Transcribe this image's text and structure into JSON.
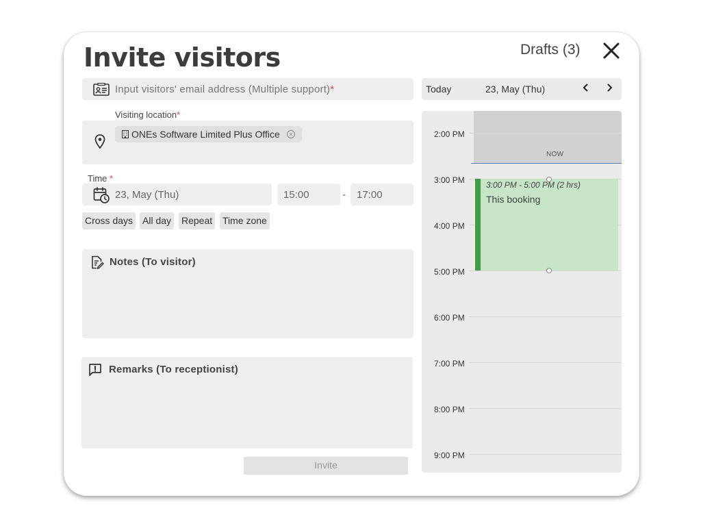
{
  "dialog": {
    "title": "Invite visitors",
    "drafts_label": "Drafts (3)"
  },
  "email": {
    "placeholder": "Input visitors' email address (Multiple support)",
    "required_mark": "*"
  },
  "location": {
    "label": "Visiting location",
    "required_mark": "*",
    "selected": "ONEs Software Limited Plus Office"
  },
  "time": {
    "label": "Time",
    "required_mark": "*",
    "date": "23, May (Thu)",
    "start": "15:00",
    "separator": "-",
    "end": "17:00"
  },
  "options": [
    "Cross days",
    "All day",
    "Repeat",
    "Time zone"
  ],
  "notes": {
    "label": "Notes (To visitor)"
  },
  "remarks": {
    "label": "Remarks (To receptionist)"
  },
  "invite_button": "Invite",
  "calendar": {
    "today_label": "Today",
    "date": "23, May (Thu)",
    "prev": "‹",
    "next": "›",
    "now_label": "NOW",
    "hours": [
      "2:00 PM",
      "3:00 PM",
      "4:00 PM",
      "5:00 PM",
      "6:00 PM",
      "7:00 PM",
      "8:00 PM",
      "9:00 PM"
    ],
    "booking": {
      "time": "3:00 PM - 5:00 PM (2 hrs)",
      "name": "This booking",
      "color": "#3f9d48"
    }
  },
  "icons": {
    "contact_card": "contact-card-icon",
    "location": "location-pin-icon",
    "calendar_clock": "calendar-clock-icon",
    "notes": "edit-note-icon",
    "remarks": "message-alert-icon",
    "close": "close-icon",
    "building": "building-icon"
  }
}
